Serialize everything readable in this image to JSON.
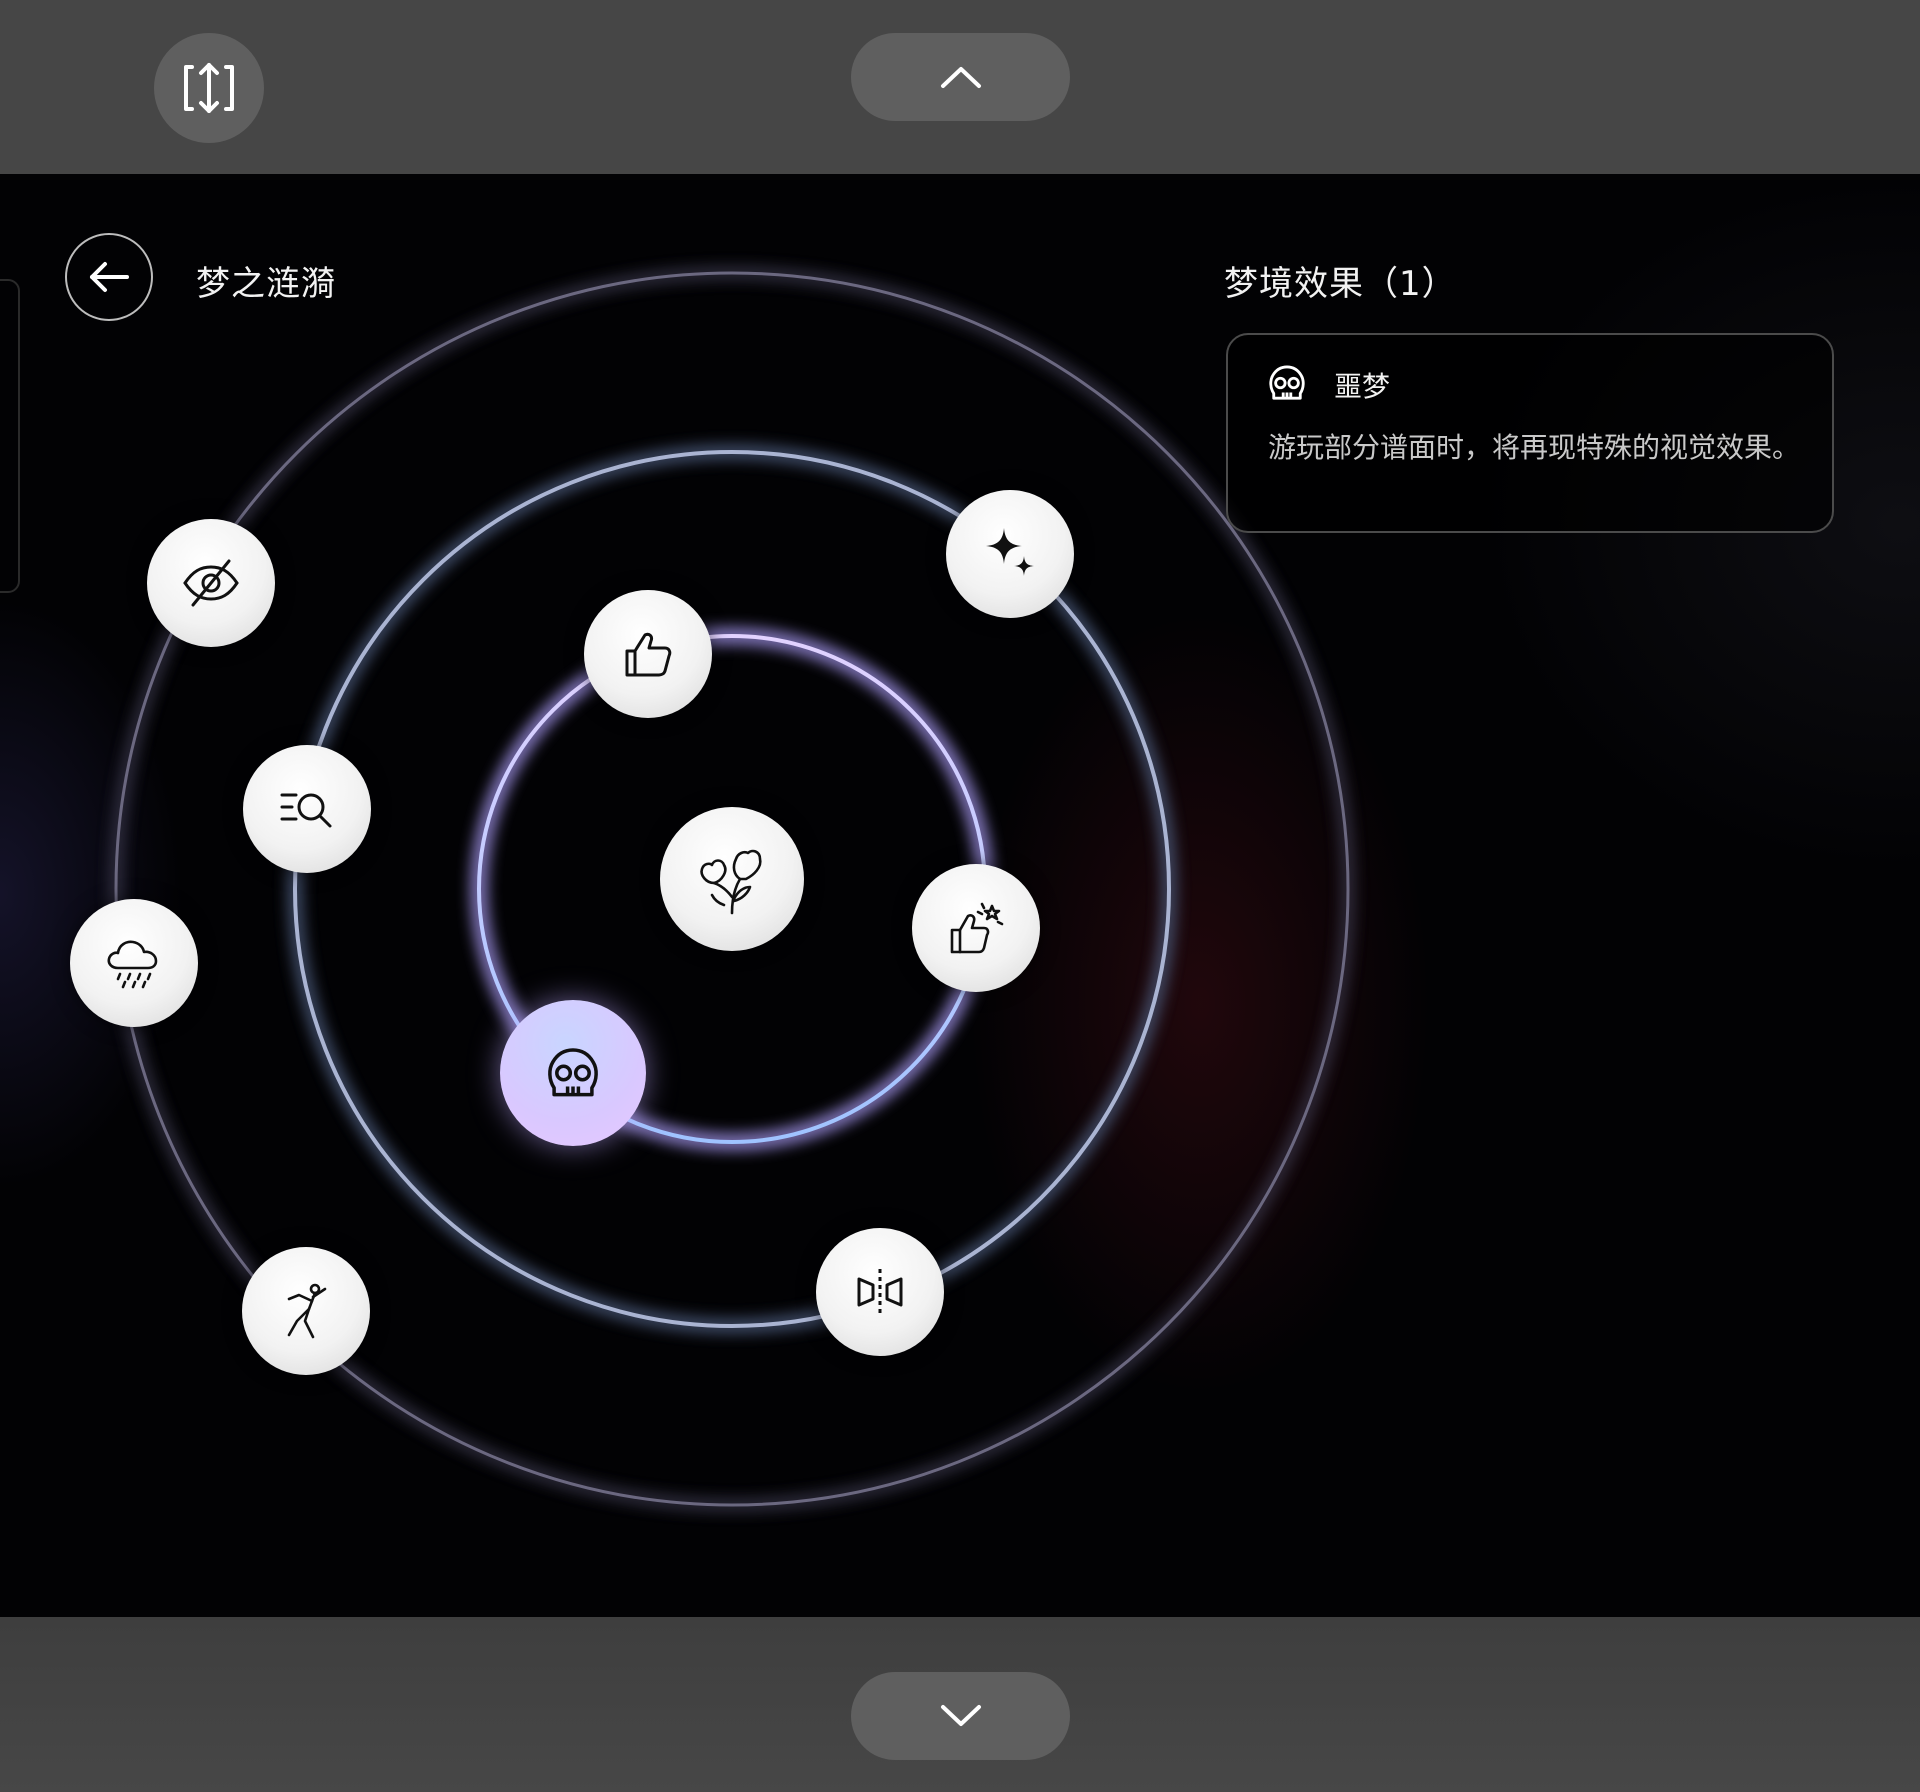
{
  "toolbar": {
    "fit_icon": "fit-vertical-icon",
    "up_icon": "chevron-up-icon",
    "down_icon": "chevron-down-icon"
  },
  "header": {
    "back_icon": "arrow-left-icon",
    "title": "梦之涟漪"
  },
  "panel": {
    "title": "梦境效果（1）",
    "effect": {
      "icon": "skull-icon",
      "name": "噩梦",
      "description": "游玩部分谱面时，将再现特殊的视觉效果。"
    }
  },
  "nodes": [
    {
      "name": "node-flowers",
      "icon": "flowers-icon"
    },
    {
      "name": "node-thumbs-up",
      "icon": "thumbs-up-icon"
    },
    {
      "name": "node-sparkles",
      "icon": "sparkles-icon"
    },
    {
      "name": "node-hidden",
      "icon": "eye-slash-icon"
    },
    {
      "name": "node-search-list",
      "icon": "list-search-icon"
    },
    {
      "name": "node-thumbs-star",
      "icon": "thumbs-up-star-icon"
    },
    {
      "name": "node-rain",
      "icon": "cloud-rain-icon"
    },
    {
      "name": "node-nightmare",
      "icon": "skull-icon",
      "selected": true
    },
    {
      "name": "node-dancer",
      "icon": "dancer-icon"
    },
    {
      "name": "node-mirror",
      "icon": "mirror-flip-icon"
    }
  ],
  "colors": {
    "bar": "#464646",
    "button": "#5f5f5f",
    "selected_node": "#d9c8ff",
    "inner_ring": "#c8bff0",
    "middle_ring": "#8e9cc4",
    "outer_ring": "#5d5a6e"
  }
}
